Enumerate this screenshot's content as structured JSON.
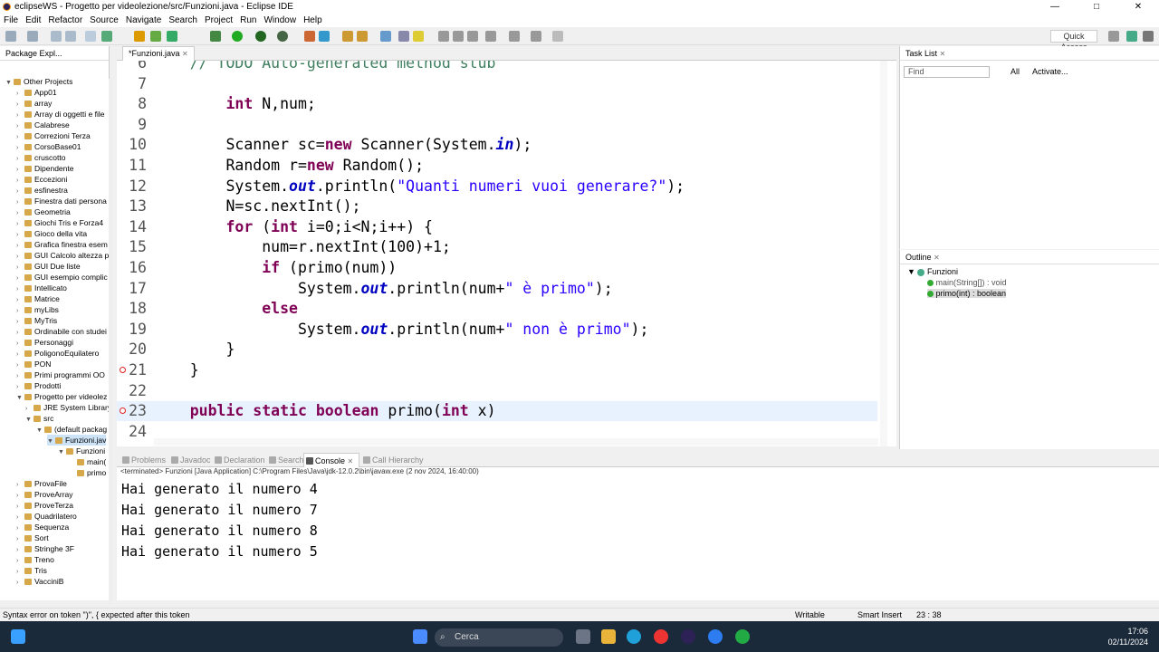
{
  "window": {
    "title": "eclipseWS - Progetto per videolezione/src/Funzioni.java - Eclipse IDE",
    "min": "—",
    "max": "□",
    "close": "✕"
  },
  "menu": [
    "File",
    "Edit",
    "Refactor",
    "Source",
    "Navigate",
    "Search",
    "Project",
    "Run",
    "Window",
    "Help"
  ],
  "toolbar": {
    "quick_access": "Quick Access"
  },
  "package_explorer": {
    "tab_label": "Package Expl...",
    "root": "Other Projects",
    "items": [
      "App01",
      "array",
      "Array di oggetti e file",
      "Calabrese",
      "Correzioni Terza",
      "CorsoBase01",
      "cruscotto",
      "Dipendente",
      "Eccezioni",
      "esfinestra",
      "Finestra dati persona",
      "Geometria",
      "Giochi Tris e Forza4",
      "Gioco della vita",
      "Grafica finestra esem",
      "GUI Calcolo altezza p",
      "GUI Due liste",
      "GUI esempio complic",
      "Intellicato",
      "Matrice",
      "myLibs",
      "MyTris",
      "Ordinabile con studei",
      "Personaggi",
      "PoligonoEquilatero",
      "PON",
      "Primi programmi OO",
      "Prodotti",
      "Progetto per videolez",
      "JRE System Library",
      "src",
      "(default packag",
      "Funzioni.jav",
      "Funzioni",
      "main(",
      "primo",
      "ProvaFile",
      "ProveArray",
      "ProveTerza",
      "Quadrilatero",
      "Sequenza",
      "Sort",
      "Stringhe 3F",
      "Treno",
      "Tris",
      "VacciniB"
    ]
  },
  "editor": {
    "tab_label": "*Funzioni.java",
    "lines": [
      {
        "n": "6",
        "t": "    // TODO Auto-generated method stub"
      },
      {
        "n": "7",
        "t": ""
      },
      {
        "n": "8",
        "t": "        int N,num;"
      },
      {
        "n": "9",
        "t": ""
      },
      {
        "n": "10",
        "t": "        Scanner sc=new Scanner(System.in);"
      },
      {
        "n": "11",
        "t": "        Random r=new Random();"
      },
      {
        "n": "12",
        "t": "        System.out.println(\"Quanti numeri vuoi generare?\");"
      },
      {
        "n": "13",
        "t": "        N=sc.nextInt();"
      },
      {
        "n": "14",
        "t": "        for (int i=0;i<N;i++) {"
      },
      {
        "n": "15",
        "t": "            num=r.nextInt(100)+1;"
      },
      {
        "n": "16",
        "t": "            if (primo(num))"
      },
      {
        "n": "17",
        "t": "                System.out.println(num+\" è primo\");"
      },
      {
        "n": "18",
        "t": "            else"
      },
      {
        "n": "19",
        "t": "                System.out.println(num+\" non è primo\");"
      },
      {
        "n": "20",
        "t": "        }"
      },
      {
        "n": "21",
        "t": "    }"
      },
      {
        "n": "22",
        "t": ""
      },
      {
        "n": "23",
        "t": "    public static boolean primo(int x)"
      },
      {
        "n": "24",
        "t": ""
      }
    ]
  },
  "tasklist": {
    "tab_label": "Task List",
    "find_placeholder": "Find",
    "all": "All",
    "activate": "Activate..."
  },
  "outline": {
    "tab_label": "Outline",
    "class_name": "Funzioni",
    "members": [
      "main(String[]) : void",
      "primo(int) : boolean"
    ]
  },
  "console": {
    "tabs": [
      "Problems",
      "Javadoc",
      "Declaration",
      "Search",
      "Console",
      "Call Hierarchy"
    ],
    "terminated": "<terminated> Funzioni [Java Application] C:\\Program Files\\Java\\jdk-12.0.2\\bin\\javaw.exe (2 nov 2024, 16:40:00)",
    "lines": [
      "Hai generato il numero 4",
      "Hai generato il numero 7",
      "Hai generato il numero 8",
      "Hai generato il numero 5"
    ]
  },
  "status": {
    "message": "Syntax error on token \")\", { expected after this token",
    "writable": "Writable",
    "insert": "Smart Insert",
    "position": "23 : 38"
  },
  "taskbar": {
    "search": "Cerca",
    "time": "17:06",
    "date": "02/11/2024"
  }
}
